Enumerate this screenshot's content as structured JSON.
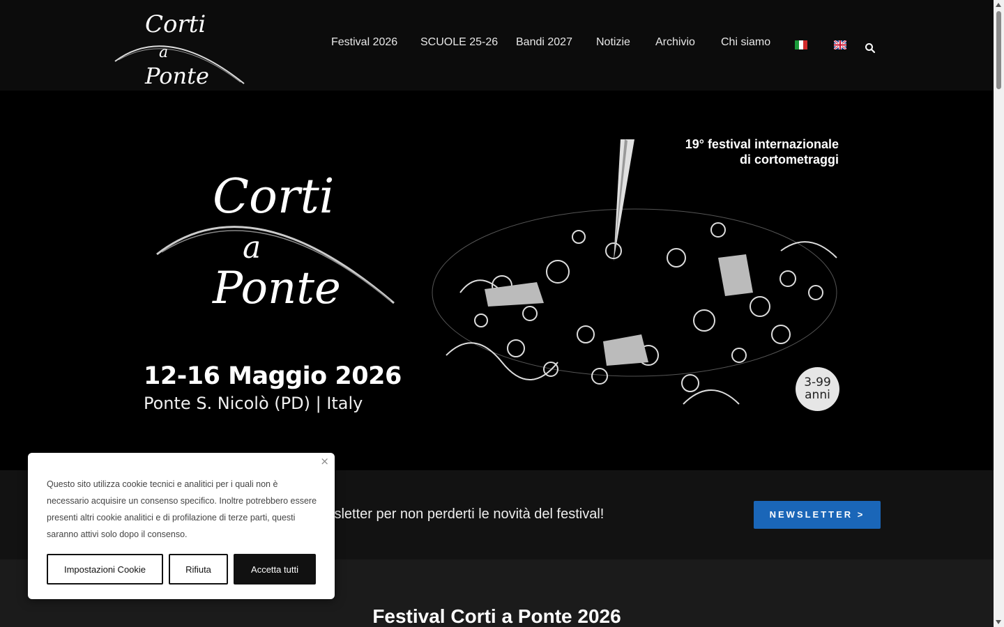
{
  "header": {
    "logo_alt": "Corti a Ponte",
    "nav": [
      {
        "label": "Festival 2026"
      },
      {
        "label": "SCUOLE 25-26"
      },
      {
        "label": "Bandi 2027"
      },
      {
        "label": "Notizie"
      },
      {
        "label": "Archivio"
      },
      {
        "label": "Chi siamo"
      }
    ],
    "languages": [
      "it-flag-icon",
      "en-flag-icon"
    ],
    "search_icon": "search-icon"
  },
  "hero": {
    "logo_text": "Corti a Ponte",
    "edition_line1": "19° festival internazionale",
    "edition_line2": "di cortometraggi",
    "dates": "12-16 Maggio 2026",
    "place": "Ponte S. Nicolò (PD) | Italy",
    "age_line1": "3-99",
    "age_line2": "anni"
  },
  "newsletter": {
    "text": "wsletter per non perderti le novità del festival!",
    "button": "NEWSLETTER >"
  },
  "section": {
    "title": "Festival Corti a Ponte 2026"
  },
  "cookie": {
    "text": "Questo sito utilizza cookie tecnici e analitici per i quali non è necessario acquisire un consenso specifico. Inoltre potrebbero essere presenti altri cookie analitici e di profilazione di terze parti, questi saranno attivi solo dopo il consenso.",
    "settings_button": "Impostazioni Cookie",
    "reject_button": "Rifiuta",
    "accept_button": "Accetta tutti",
    "close_icon": "×"
  },
  "colors": {
    "accent": "#1a66b8",
    "background": "#000000",
    "header": "#0c0c0c"
  }
}
